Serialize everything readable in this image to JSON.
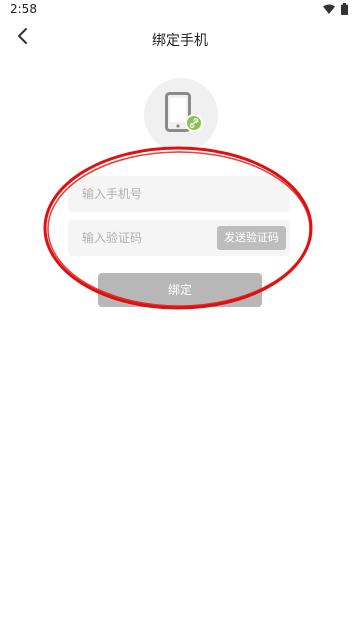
{
  "status_bar": {
    "time": "2:58",
    "icons": [
      "wifi-icon",
      "battery-icon"
    ]
  },
  "toolbar": {
    "back_icon": "chevron-left-icon",
    "title": "绑定手机"
  },
  "illustration": {
    "phone_icon": "smartphone-icon",
    "badge_icon": "link-icon",
    "badge_color": "#8bc34a"
  },
  "form": {
    "phone_placeholder": "输入手机号",
    "phone_value": "",
    "code_placeholder": "输入验证码",
    "code_value": "",
    "send_code_label": "发送验证码",
    "bind_label": "绑定"
  },
  "colors": {
    "annotation": "#e01010",
    "button_disabled": "#b7b7b7",
    "field_bg": "#f5f5f5"
  }
}
